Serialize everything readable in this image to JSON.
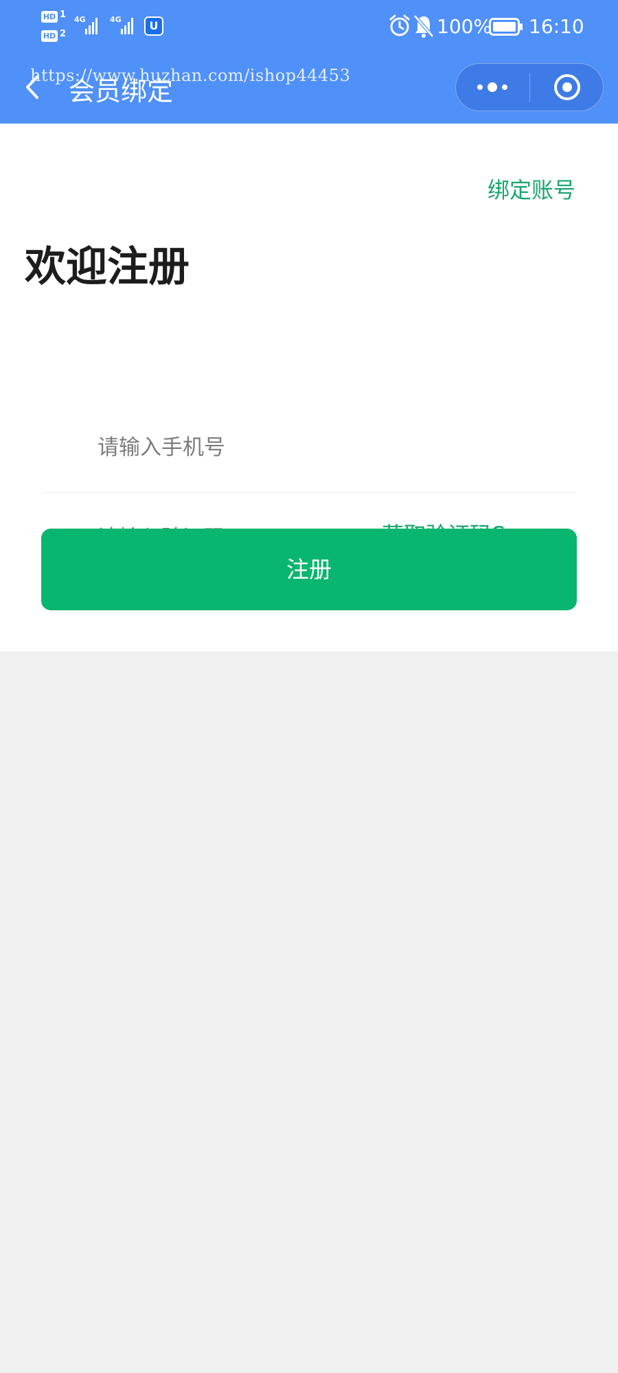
{
  "status_bar": {
    "sim1_badge": "HD",
    "sim1_num": "1",
    "sim2_badge": "HD",
    "sim2_num": "2",
    "net1_label": "4G",
    "net2_label": "4G",
    "app_icon_glyph": "U",
    "battery_percent": "100%",
    "time": "16:10",
    "icons": [
      "signal-bars-icon",
      "app-notification-icon",
      "alarm-icon",
      "mute-bell-icon",
      "battery-icon"
    ]
  },
  "nav": {
    "title": "会员绑定",
    "watermark": "https://www.huzhan.com/ishop44453",
    "back_icon": "chevron-left-icon",
    "more_icon": "more-dots-icon",
    "close_icon": "target-circle-icon"
  },
  "form": {
    "bind_account_link": "绑定账号",
    "heading": "欢迎注册",
    "phone_placeholder": "请输入手机号",
    "phone_value": "",
    "code_placeholder": "请输入验证码",
    "code_value": "",
    "get_code_label": "获取验证码S",
    "submit_label": "注册"
  },
  "colors": {
    "header_bg": "#4f90f9",
    "accent_green": "#17a66e",
    "button_green": "#09b66f",
    "page_bg": "#f0f0f0"
  }
}
